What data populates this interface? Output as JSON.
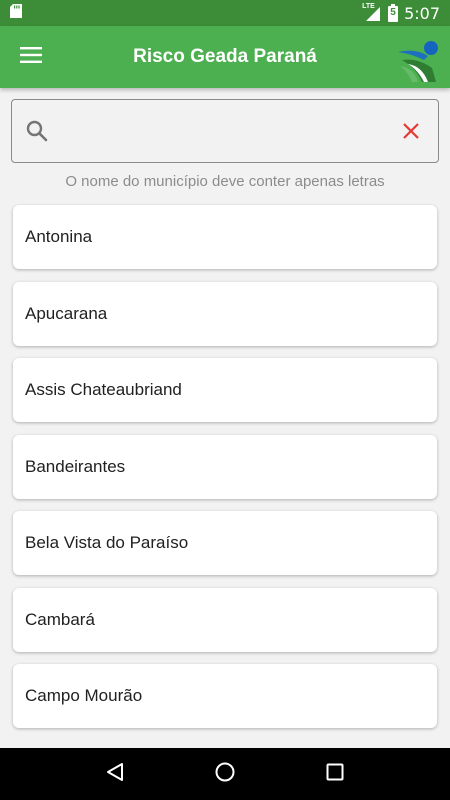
{
  "status_bar": {
    "network_label": "LTE",
    "battery_level": "5",
    "time": "5:07",
    "icons": [
      "sd-card-icon",
      "signal-icon",
      "battery-icon"
    ]
  },
  "app_bar": {
    "title": "Risco Geada Paraná",
    "menu_icon": "menu-icon",
    "logo_icon": "app-logo-icon"
  },
  "search": {
    "value": "",
    "placeholder": "",
    "search_icon": "search-icon",
    "clear_icon": "close-icon",
    "hint": "O nome do município deve conter apenas letras"
  },
  "municipalities": [
    {
      "label": "Antonina"
    },
    {
      "label": "Apucarana"
    },
    {
      "label": "Assis Chateaubriand"
    },
    {
      "label": "Bandeirantes"
    },
    {
      "label": "Bela Vista do Paraíso"
    },
    {
      "label": "Cambará"
    },
    {
      "label": "Campo Mourão"
    }
  ],
  "nav_bar": {
    "icons": [
      "back-icon",
      "home-icon",
      "recents-icon"
    ]
  },
  "colors": {
    "app_bar": "#4caf50",
    "status_bar": "#3d8d38",
    "clear_icon": "#e53935",
    "background": "#f2f2f2"
  }
}
